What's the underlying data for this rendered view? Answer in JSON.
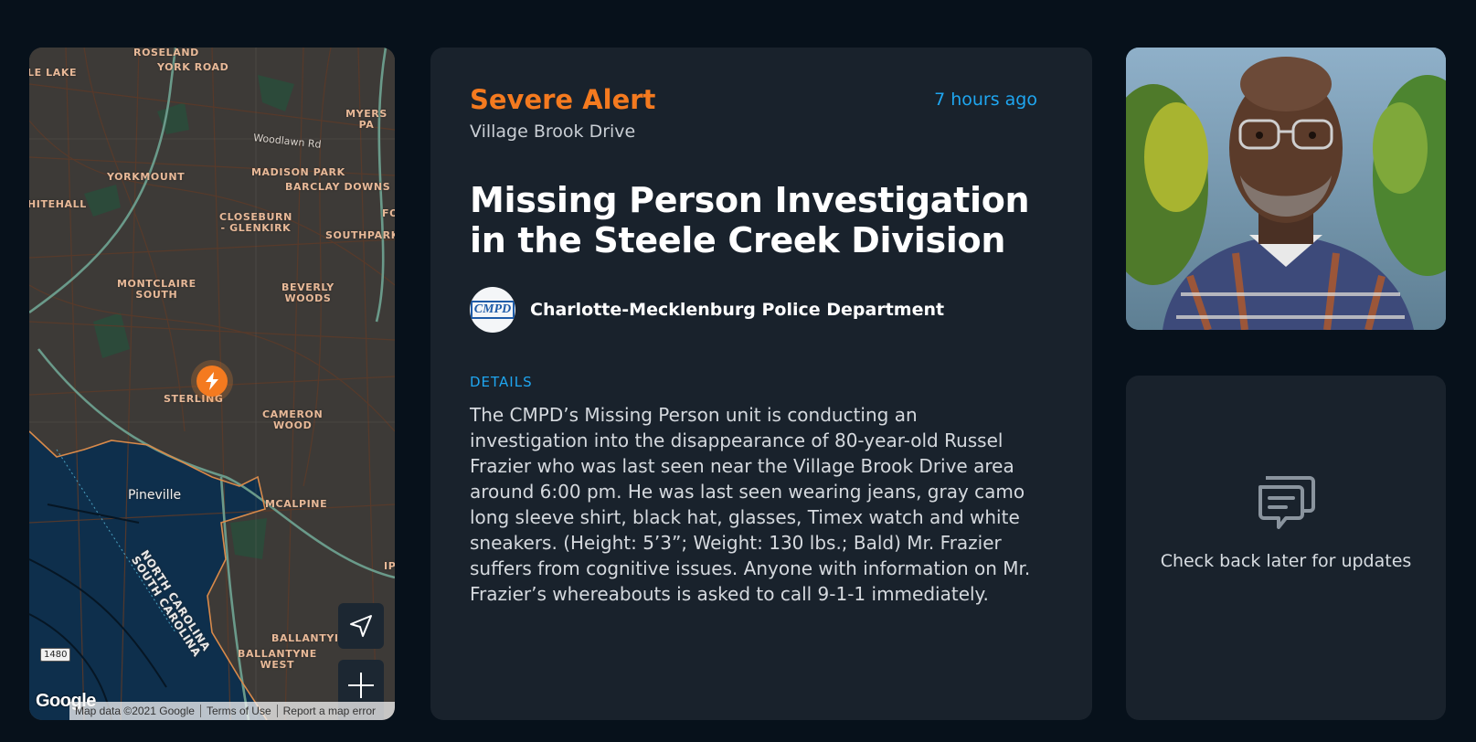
{
  "map": {
    "labels": {
      "roseland": "ROSELAND",
      "york_road": "YORK ROAD",
      "lake": "LE LAKE",
      "myers_park": "MYERS PA",
      "woodlawn": "Woodlawn Rd",
      "yorkmount": "YORKMOUNT",
      "madison_park": "MADISON PARK",
      "barclay_downs": "BARCLAY DOWNS",
      "whitehall": "HITEHALL",
      "closeburn": "CLOSEBURN\n- GLENKIRK",
      "fo": "FO",
      "southpark": "SOUTHPARK",
      "montclaire": "MONTCLAIRE\nSOUTH",
      "beverly_woods": "BEVERLY\nWOODS",
      "sterling": "STERLING",
      "cameron_wood": "CAMERON\nWOOD",
      "pineville": "Pineville",
      "mcalpine": "MCALPINE",
      "nc_sc": "NORTH CAROLINA\nSOUTH CAROLINA",
      "ballantyne": "BALLANTYI",
      "ballantyne_west": "BALLANTYNE\nWEST",
      "ip": "IP",
      "highway_shield": "1480"
    },
    "google_logo": "Google",
    "attribution": [
      "Map data ©2021 Google",
      "Terms of Use",
      "Report a map error"
    ],
    "marker_icon": "lightning-icon",
    "controls": {
      "locate_icon": "navigation-arrow-icon",
      "zoom_in_icon": "plus-icon",
      "zoom_out_icon": "minus-icon"
    }
  },
  "alert": {
    "severity": "Severe Alert",
    "location": "Village Brook Drive",
    "time_ago": "7 hours ago",
    "title": "Missing Person Investigation in the Steele Creek Division",
    "agency_name": "Charlotte-Mecklenburg Police Department",
    "agency_logo_text": "CMPD",
    "details_label": "DETAILS",
    "details_text": "The CMPD’s Missing Person unit is conducting an investigation into the disappearance of 80-year-old Russel Frazier who was last seen near the Village Brook Drive area around 6:00 pm. He was last seen wearing jeans, gray camo long sleeve shirt, black hat, glasses, Timex watch and white sneakers. (Height: 5’3”; Weight: 130 lbs.; Bald) Mr. Frazier suffers from cognitive issues. Anyone with information on Mr. Frazier’s whereabouts is asked to call 9-1-1 immediately."
  },
  "updates": {
    "icon": "chat-bubbles-icon",
    "message": "Check back later for updates"
  },
  "colors": {
    "accent_orange": "#f47a1f",
    "accent_blue": "#1fa6f0",
    "card_bg": "#19222c",
    "page_bg": "#07111b"
  }
}
